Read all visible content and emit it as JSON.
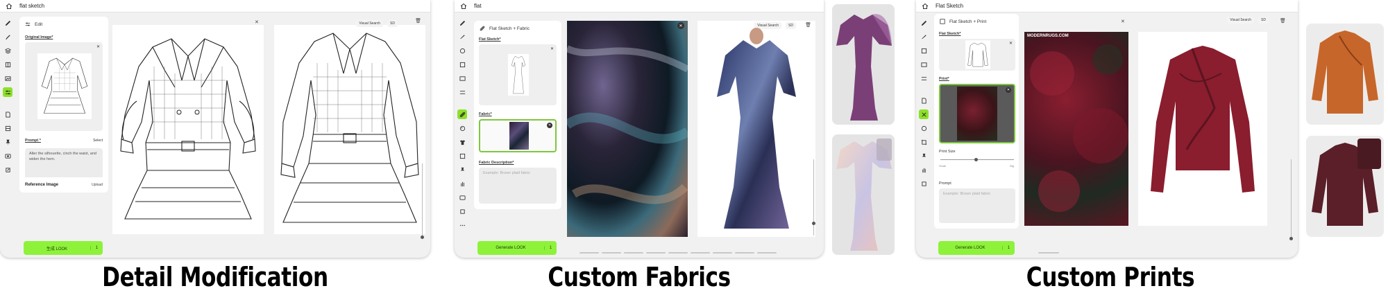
{
  "panels": [
    {
      "window_title": "flat sketch",
      "panel_header": "Edit",
      "original_label": "Original Image*",
      "prompt_label": "Prompt *",
      "select_label": "Select",
      "prompt_text": "Alter the silhouette, cinch the waist, and widen the hem.",
      "reference_label": "Reference Image",
      "upload_label": "Upload",
      "generate_label": "生成 LOOK",
      "generate_count": "1",
      "toolbar": {
        "visual_search": "Visual Search",
        "sd": "SD"
      },
      "caption": "Detail Modification"
    },
    {
      "window_title": "flat",
      "panel_header": "Flat Sketch + Fabric",
      "sketch_label": "Flat Sketch*",
      "fabric_label": "Fabric*",
      "desc_label": "Fabric Description*",
      "desc_placeholder": "Example: Brown plaid fabric",
      "generate_label": "Generate LOOK",
      "generate_count": "1",
      "toolbar": {
        "visual_search": "Visual Search",
        "sd": "SD"
      },
      "caption": "Custom Fabrics"
    },
    {
      "window_title": "Flat Sketch",
      "panel_header": "Flat Sketch + Print",
      "sketch_label": "Flat Sketch*",
      "print_label": "Print*",
      "print_size_label": "Print Size",
      "size_small": "Small",
      "size_big": "Big",
      "prompt_label": "Prompt",
      "prompt_placeholder": "Example: Brown plaid fabric",
      "generate_label": "Generate LOOK",
      "generate_count": "1",
      "toolbar": {
        "visual_search": "Visual Search",
        "sd": "SD"
      },
      "watermark": "MODERNRUGS.COM",
      "caption": "Custom Prints"
    }
  ],
  "colors": {
    "accent_green": "#8ef23b",
    "active_rail": "#8ee02a",
    "window_bg": "#f1f1f1"
  }
}
